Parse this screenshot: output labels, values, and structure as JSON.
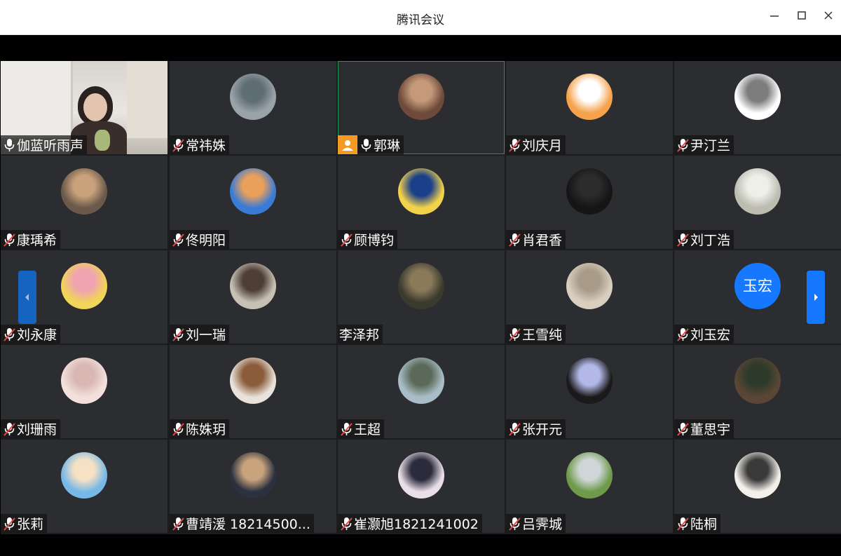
{
  "window": {
    "title": "腾讯会议",
    "controls": {
      "minimize": "—",
      "maximize": "☐",
      "close": "✕"
    }
  },
  "participants": [
    {
      "name": "伽蓝听雨声",
      "mic": "on",
      "video": true,
      "colors": [
        "#d8d4cf",
        "#3a2e2a"
      ]
    },
    {
      "name": "常祎姝",
      "mic": "muted",
      "colors": [
        "#9aa3a8",
        "#5f6d74"
      ]
    },
    {
      "name": "郭琳",
      "mic": "on",
      "host": true,
      "active": true,
      "colors": [
        "#6e4a3a",
        "#c49a7a"
      ]
    },
    {
      "name": "刘庆月",
      "mic": "muted",
      "colors": [
        "#f5a24b",
        "#ffffff"
      ]
    },
    {
      "name": "尹汀兰",
      "mic": "muted",
      "colors": [
        "#ffffff",
        "#7d7d7d"
      ]
    },
    {
      "name": "康瑀希",
      "mic": "muted",
      "colors": [
        "#6b5a4b",
        "#c9a27b"
      ]
    },
    {
      "name": "佟明阳",
      "mic": "muted",
      "colors": [
        "#3a7bd5",
        "#e8a05a"
      ]
    },
    {
      "name": "顾博钧",
      "mic": "muted",
      "colors": [
        "#f2d24a",
        "#1c3f8a"
      ]
    },
    {
      "name": "肖君香",
      "mic": "muted",
      "colors": [
        "#151515",
        "#2c2c2c"
      ]
    },
    {
      "name": "刘丁浩",
      "mic": "muted",
      "colors": [
        "#bcbcb0",
        "#efefea"
      ]
    },
    {
      "name": "刘永康",
      "mic": "muted",
      "colors": [
        "#f1d45a",
        "#f0a3b0"
      ]
    },
    {
      "name": "刘一瑞",
      "mic": "muted",
      "colors": [
        "#c7c0b5",
        "#4e3f36"
      ]
    },
    {
      "name": "李泽邦",
      "mic": "none",
      "colors": [
        "#3a3a2e",
        "#8b7a5a"
      ]
    },
    {
      "name": "王雪纯",
      "mic": "muted",
      "colors": [
        "#d9cfc0",
        "#a89b88"
      ]
    },
    {
      "name": "刘玉宏",
      "mic": "muted",
      "avatar_text": "玉宏",
      "colors": [
        "#1677ff",
        "#1677ff"
      ]
    },
    {
      "name": "刘珊雨",
      "mic": "muted",
      "colors": [
        "#f3e0dc",
        "#d9b8b4"
      ]
    },
    {
      "name": "陈姝玥",
      "mic": "muted",
      "colors": [
        "#e8e2da",
        "#8a5c3a"
      ]
    },
    {
      "name": "王超",
      "mic": "muted",
      "colors": [
        "#a9bdc8",
        "#5b6a58"
      ]
    },
    {
      "name": "张开元",
      "mic": "muted",
      "colors": [
        "#1a1a1a",
        "#b4b8e8"
      ]
    },
    {
      "name": "董思宇",
      "mic": "muted",
      "colors": [
        "#5a4636",
        "#2d3a2a"
      ]
    },
    {
      "name": "张莉",
      "mic": "muted",
      "colors": [
        "#78b8e6",
        "#f6e1c4"
      ]
    },
    {
      "name": "曹靖湲 18214500...",
      "mic": "muted",
      "colors": [
        "#2c3140",
        "#c9a37c"
      ]
    },
    {
      "name": "崔灏旭1821241002",
      "mic": "muted",
      "colors": [
        "#eadfe8",
        "#2b2b3c"
      ]
    },
    {
      "name": "吕霁城",
      "mic": "muted",
      "colors": [
        "#6e9a4a",
        "#cfd6d8"
      ]
    },
    {
      "name": "陆桐",
      "mic": "muted",
      "colors": [
        "#f3efe9",
        "#3a3a3a"
      ]
    }
  ],
  "accent": {
    "host": "#f59a23",
    "active_border": "#1f9d55",
    "nav": "#1677ff"
  }
}
